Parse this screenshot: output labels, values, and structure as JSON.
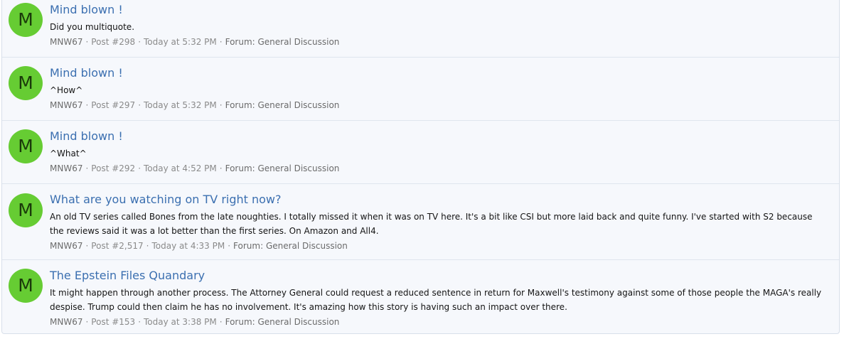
{
  "results": [
    {
      "avatar_letter": "M",
      "title": "Mind blown !",
      "snippet": "Did you multiquote.",
      "author": "MNW67",
      "post": "Post #298",
      "time": "Today at 5:32 PM",
      "forum": "Forum: General Discussion"
    },
    {
      "avatar_letter": "M",
      "title": "Mind blown !",
      "snippet": "^How^",
      "author": "MNW67",
      "post": "Post #297",
      "time": "Today at 5:32 PM",
      "forum": "Forum: General Discussion"
    },
    {
      "avatar_letter": "M",
      "title": "Mind blown !",
      "snippet": "^What^",
      "author": "MNW67",
      "post": "Post #292",
      "time": "Today at 4:52 PM",
      "forum": "Forum: General Discussion"
    },
    {
      "avatar_letter": "M",
      "title": "What are you watching on TV right now?",
      "snippet": "An old TV series called Bones from the late noughties. I totally missed it when it was on TV here. It's a bit like CSI but more laid back and quite funny. I've started with S2 because the reviews said it was a lot better than the first series. On Amazon and All4.",
      "author": "MNW67",
      "post": "Post #2,517",
      "time": "Today at 4:33 PM",
      "forum": "Forum: General Discussion"
    },
    {
      "avatar_letter": "M",
      "title": "The Epstein Files Quandary",
      "snippet": "It might happen through another process. The Attorney General could request a reduced sentence in return for Maxwell's testimony against some of those people the MAGA's really despise. Trump could then claim he has no involvement. It's amazing how this story is having such an impact over there.",
      "author": "MNW67",
      "post": "Post #153",
      "time": "Today at 3:38 PM",
      "forum": "Forum: General Discussion"
    }
  ],
  "meta_separator": "·",
  "colors": {
    "avatar_bg": "#66cc33",
    "title_link": "#3b6fb0",
    "meta_text": "#8a8a8a",
    "panel_bg": "#f6f8fc"
  }
}
